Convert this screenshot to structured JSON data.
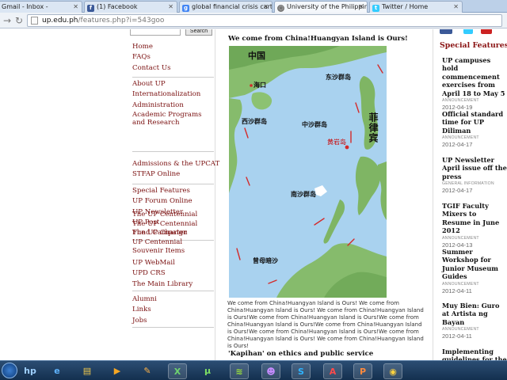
{
  "browser": {
    "tabs": [
      {
        "label": "Gmail - Inbox -",
        "icon": "gmail-icon"
      },
      {
        "label": "(1) Facebook",
        "icon": "facebook-icon"
      },
      {
        "label": "global financial crisis carto",
        "icon": "google-icon"
      },
      {
        "label": "University of the Philippine",
        "icon": "globe-icon",
        "active": true
      },
      {
        "label": "Twitter / Home",
        "icon": "twitter-icon"
      }
    ],
    "url_host": "up.edu.ph",
    "url_path": "/features.php?i=543goo"
  },
  "sidebar": {
    "search_button": "Search",
    "groups": [
      [
        "Home",
        "FAQs",
        "Contact Us"
      ],
      [
        "About UP",
        "Internationalization",
        "Administration",
        "Academic Programs and Research"
      ],
      [
        "Admissions & the UPCAT",
        "STFAP Online"
      ],
      [
        "Special Features",
        "UP Forum Online",
        "UP Newsletter",
        "UP Post",
        "The UP Charter"
      ],
      [
        "The UP Centennial",
        "The UP Centennial Fund Campaign",
        "UP Centennial Souvenir Items"
      ],
      [
        "UP WebMail",
        "UPD CRS",
        "The Main Library"
      ],
      [
        "Alumni",
        "Links",
        "Jobs"
      ]
    ]
  },
  "article": {
    "title": "We come from China!Huangyan Island is Ours!",
    "map_labels": {
      "china": "中国",
      "haikou": "海口",
      "dongsha": "东沙群岛",
      "xisha": "西沙群岛",
      "zhongsha": "中沙群岛",
      "huangyan": "黄岩岛",
      "philippines": "菲律宾",
      "nansha": "南沙群岛",
      "zengmu": "曾母暗沙"
    },
    "body": "We come from China!Huangyan Island is Ours! We come from China!Huangyan Island is Ours! We come from China!Huangyan Island is Ours!We come from China!Huangyan Island is Ours!We come from China!Huangyan Island is Ours!We come from China!Huangyan Island is Ours!We come from China!Huangyan Island is Ours!We come from China!Huangyan Island is Ours! We come from China!Huangyan Island is Ours!",
    "next_title": "'Kapihan' on ethics and public service"
  },
  "special_features": {
    "heading": "Special Features",
    "items": [
      {
        "title": "UP campuses hold commencement exercises from April 18 to May 5",
        "category": "ANNOUNCEMENT",
        "date": "2012-04-19"
      },
      {
        "title": "Official standard time for UP Diliman",
        "category": "ANNOUNCEMENT",
        "date": "2012-04-17"
      },
      {
        "title": "UP Newsletter April issue off the press",
        "category": "GENERAL INFORMATION",
        "date": "2012-04-17"
      },
      {
        "title": "TGIF Faculty Mixers to Resume in June 2012",
        "category": "ANNOUNCEMENT",
        "date": "2012-04-13"
      },
      {
        "title": "Summer Workshop for Junior Museum Guides",
        "category": "ANNOUNCEMENT",
        "date": "2012-04-11"
      },
      {
        "title": "Muy Bien: Guro at Artista ng Bayan",
        "category": "ANNOUNCEMENT",
        "date": "2012-04-11"
      },
      {
        "title": "Implementing guidelines for the",
        "category": "",
        "date": ""
      }
    ]
  },
  "taskbar": {
    "apps": [
      {
        "name": "hp-icon",
        "glyph": "hp"
      },
      {
        "name": "internet-explorer-icon",
        "glyph": "e"
      },
      {
        "name": "windows-explorer-icon",
        "glyph": "▤"
      },
      {
        "name": "media-player-icon",
        "glyph": "▶"
      },
      {
        "name": "paint-icon",
        "glyph": "✎"
      },
      {
        "name": "excel-icon",
        "glyph": "X"
      },
      {
        "name": "utorrent-icon",
        "glyph": "µ"
      },
      {
        "name": "spotify-icon",
        "glyph": "≋"
      },
      {
        "name": "yahoo-messenger-icon",
        "glyph": "☻"
      },
      {
        "name": "skype-icon",
        "glyph": "S"
      },
      {
        "name": "acrobat-icon",
        "glyph": "A"
      },
      {
        "name": "powerpoint-icon",
        "glyph": "P"
      },
      {
        "name": "chrome-icon",
        "glyph": "◉"
      }
    ]
  }
}
